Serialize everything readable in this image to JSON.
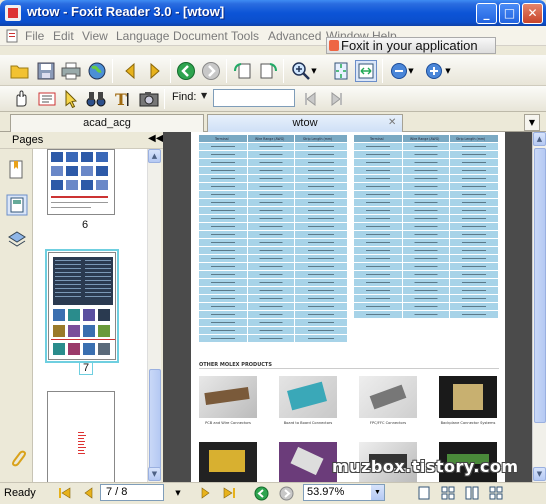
{
  "window": {
    "title": "wtow - Foxit Reader 3.0 - [wtow]"
  },
  "menu": [
    "File",
    "Edit",
    "View",
    "Language",
    "Document",
    "Tools",
    "Advanced",
    "Window",
    "Help"
  ],
  "banner": "Foxit in your application",
  "findbar": {
    "label": "Find:",
    "value": ""
  },
  "tabs": {
    "inactive": "acad_acg",
    "active": "wtow"
  },
  "sidebar": {
    "title": "Pages",
    "page_numbers": [
      "6",
      "7"
    ]
  },
  "document": {
    "table_left_headers": [
      "Terminal",
      "Wire Range (AWG)",
      "Strip Length (mm)"
    ],
    "table_right_headers": [
      "Terminal",
      "Wire Range (AWG)",
      "Strip Length (mm)"
    ],
    "section_title": "OTHER MOLEX PRODUCTS",
    "products": [
      "PCB and Wire Connectors",
      "Board to Board Connectors",
      "FPC/FFC Connectors",
      "Backplane Connector Systems"
    ]
  },
  "status": {
    "text": "Ready",
    "page": "7 / 8",
    "zoom": "53.97%"
  },
  "watermark": "muzbox.tistory.com",
  "colors": {
    "titlebar": "#0c54d7",
    "table_header": "#7aa9c3",
    "table_cell": "#a7d3e8"
  }
}
